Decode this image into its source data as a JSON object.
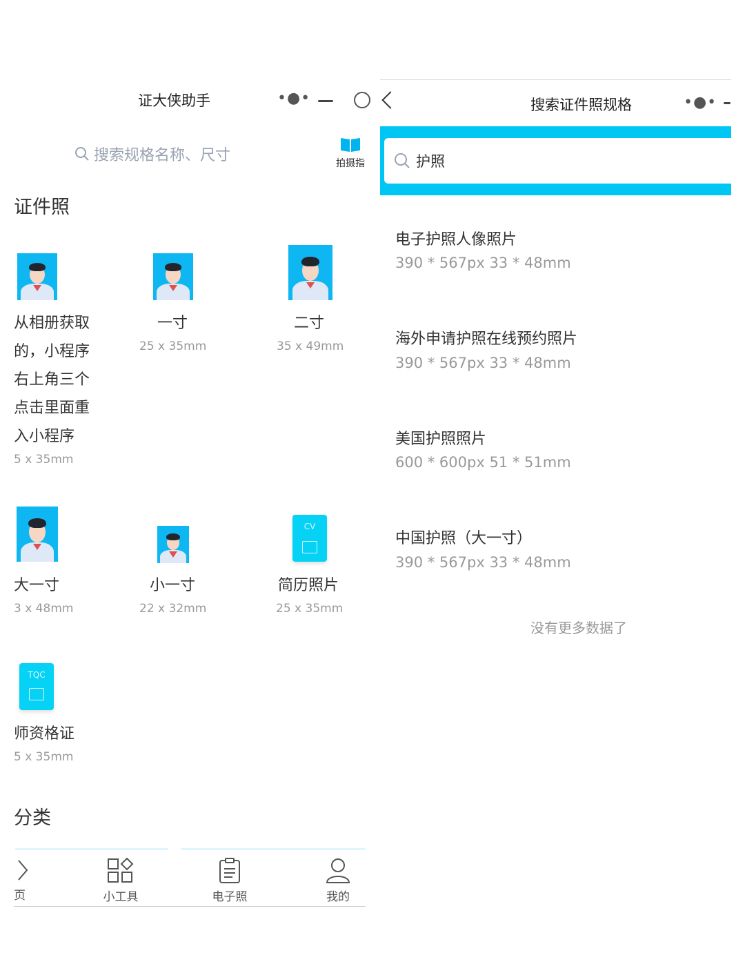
{
  "left": {
    "title": "证大侠助手",
    "search_placeholder": "搜索规格名称、尺寸",
    "guide_label": "拍摄指",
    "section_idphoto": "证件照",
    "items": [
      {
        "name_lines": [
          "从相册获取",
          "的，小程序",
          "右上角三个",
          "点击里面重",
          "入小程序"
        ],
        "size": "5 x 35mm"
      },
      {
        "name": "一寸",
        "size": "25 x 35mm"
      },
      {
        "name": "二寸",
        "size": "35 x 49mm"
      },
      {
        "name": "大一寸",
        "size": "3 x 48mm"
      },
      {
        "name": "小一寸",
        "size": "22 x 32mm"
      },
      {
        "name": "简历照片",
        "size": "25 x 35mm",
        "tag": "CV"
      },
      {
        "name": "师资格证",
        "size": "5 x 35mm",
        "tag": "TQC"
      }
    ],
    "section_category": "分类",
    "tabs": [
      {
        "label": "页",
        "icon": "home-icon"
      },
      {
        "label": "小工具",
        "icon": "grid-icon"
      },
      {
        "label": "电子照",
        "icon": "document-icon"
      },
      {
        "label": "我的",
        "icon": "user-icon"
      }
    ]
  },
  "right": {
    "title": "搜索证件照规格",
    "search_value": "护照",
    "results": [
      {
        "name": "电子护照人像照片",
        "spec": "390 * 567px   33 * 48mm"
      },
      {
        "name": "海外申请护照在线预约照片",
        "spec": "390 * 567px   33 * 48mm"
      },
      {
        "name": "美国护照照片",
        "spec": "600 * 600px   51 * 51mm"
      },
      {
        "name": "中国护照（大一寸）",
        "spec": "390 * 567px   33 * 48mm"
      }
    ],
    "end_text": "没有更多数据了"
  },
  "colors": {
    "accent": "#00c6f3",
    "photo_bg": "#0fb7f2",
    "doc_card": "#05d2f5"
  }
}
